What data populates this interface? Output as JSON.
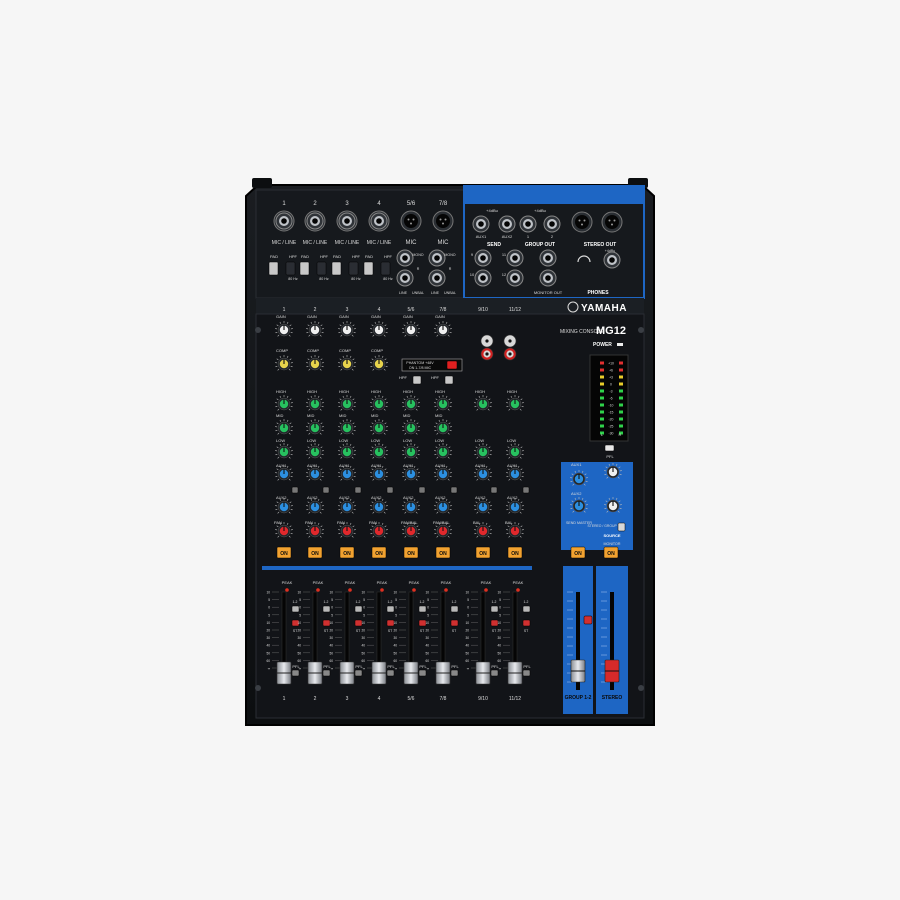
{
  "brand": "YAMAHA",
  "model": "MG12",
  "console_label": "MIXING CONSOLE",
  "input_top_numbers": [
    "1",
    "2",
    "3",
    "4",
    "5/6",
    "7/8"
  ],
  "mic_line_labels": [
    "MIC / LINE",
    "MIC / LINE",
    "MIC / LINE",
    "MIC / LINE"
  ],
  "mic_label": "MIC",
  "pad_label": "PAD",
  "hpf_label": "HPF",
  "hpf_freq": "80 Hz",
  "stereo_line_labels": [
    "MONO",
    "L",
    "R",
    "LINE",
    "UNBAL"
  ],
  "phantom_text": [
    "PHANTOM +48V",
    "ON 1-7/8 MIC"
  ],
  "knob_labels": {
    "gain": "GAIN",
    "comp": "COMP",
    "high": "HIGH",
    "mid": "MID",
    "low": "LOW",
    "aux1": "AUX1",
    "aux2": "AUX2",
    "pan": "PAN",
    "pan_bal": "PAN/BAL",
    "bal": "BAL"
  },
  "on_label": "ON",
  "peak_label": "PEAK",
  "pfl_label": "PFL",
  "st_label": "ST",
  "bus_1_2_label": "1-2",
  "channel_strip_numbers": [
    "1",
    "2",
    "3",
    "4",
    "5/6",
    "7/8",
    "9/10",
    "11/12"
  ],
  "jack_top": {
    "send_level": "+4dBu",
    "aux1": "AUX1",
    "aux2": "AUX2",
    "send": "SEND",
    "group_out": "GROUP OUT",
    "group_1": "1",
    "group_2": "2",
    "stereo_out": "STEREO OUT",
    "stereo_out_level": "+4dBu",
    "monitor_out": "MONITOR OUT",
    "phones": "PHONES",
    "line_nums": [
      "9",
      "10",
      "11",
      "12"
    ]
  },
  "master": {
    "power": "POWER",
    "pfl": "PFL",
    "meter_scale": [
      "+10",
      "+6",
      "+3",
      "0",
      "-3",
      "-6",
      "-10",
      "-15",
      "-20",
      "-25",
      "-30"
    ],
    "meter_lr": [
      "L",
      "R"
    ],
    "aux1": "AUX1",
    "aux2": "AUX2",
    "send_master": "SEND MASTER",
    "monitor": "MONITOR",
    "phones": "PHONES",
    "source": "SOURCE",
    "source_options": "STEREO / GROUP 1-2",
    "group_label": "GROUP 1-2",
    "stereo_label": "STEREO"
  },
  "fader_scale": [
    "10",
    "5",
    "0",
    "5",
    "10",
    "20",
    "30",
    "40",
    "50",
    "60",
    "∞"
  ],
  "knob_colors": {
    "gain": "#f0f0f0",
    "comp": "#e8d44c",
    "high": "#27c15f",
    "mid": "#27c15f",
    "low": "#27c15f",
    "aux": "#2c8fe0",
    "pan": "#e0282c"
  },
  "colors": {
    "body": "#0f1114",
    "panel": "#15181c",
    "accent_blue": "#1e66c4",
    "on_button": "#f2a230",
    "peak_led": "#e03020",
    "meter_green": "#2fd24a",
    "meter_yellow": "#e8cc2a",
    "meter_red": "#e03030"
  }
}
